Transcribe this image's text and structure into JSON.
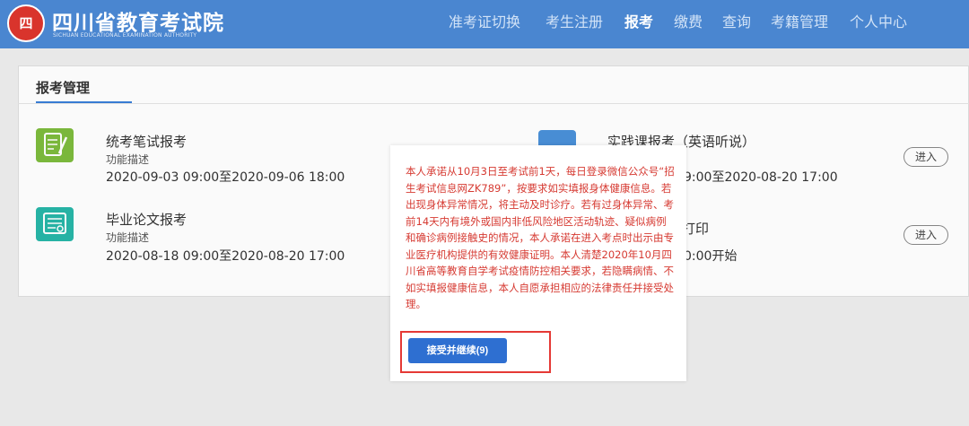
{
  "header": {
    "logo_mark": "四",
    "site_name": "四川省教育考试院",
    "site_name_en": "SICHUAN EDUCATIONAL EXAMINATION AUTHORITY",
    "nav": [
      {
        "label": "准考证切换"
      },
      {
        "label": "考生注册"
      },
      {
        "label": "报考",
        "active": true
      },
      {
        "label": "缴费"
      },
      {
        "label": "查询"
      },
      {
        "label": "考籍管理"
      },
      {
        "label": "个人中心"
      }
    ]
  },
  "main": {
    "tab_label": "报考管理",
    "items": [
      {
        "title": "统考笔试报考",
        "desc": "功能描述",
        "date": "2020-09-03 09:00至2020-09-06 18:00",
        "icon": "notebook-icon"
      },
      {
        "title": "毕业论文报考",
        "desc": "功能描述",
        "date": "2020-08-18 09:00至2020-08-20 17:00",
        "icon": "certificate-icon"
      },
      {
        "title": "实践课报考（英语听说）",
        "date": "9:00至2020-08-20 17:00",
        "icon": "practice-icon",
        "button": "进入"
      },
      {
        "title": "打印",
        "date": "0:00开始",
        "button": "进入"
      }
    ]
  },
  "modal": {
    "text": "本人承诺从10月3日至考试前1天，每日登录微信公众号“招生考试信息网ZK789”，按要求如实填报身体健康信息。若出现身体异常情况，将主动及时诊疗。若有过身体异常、考前14天内有境外或国内非低风险地区活动轨迹、疑似病例和确诊病例接触史的情况，本人承诺在进入考点时出示由专业医疗机构提供的有效健康证明。本人清楚2020年10月四川省高等教育自学考试疫情防控相关要求，若隐瞒病情、不如实填报健康信息，本人自愿承担相应的法律责任并接受处理。",
    "accept_label": "接受并继续(9)"
  },
  "colors": {
    "header_bg": "#4a86d0",
    "accent": "#2e6fd1",
    "modal_text": "#d63a32",
    "highlight": "#e53935"
  }
}
